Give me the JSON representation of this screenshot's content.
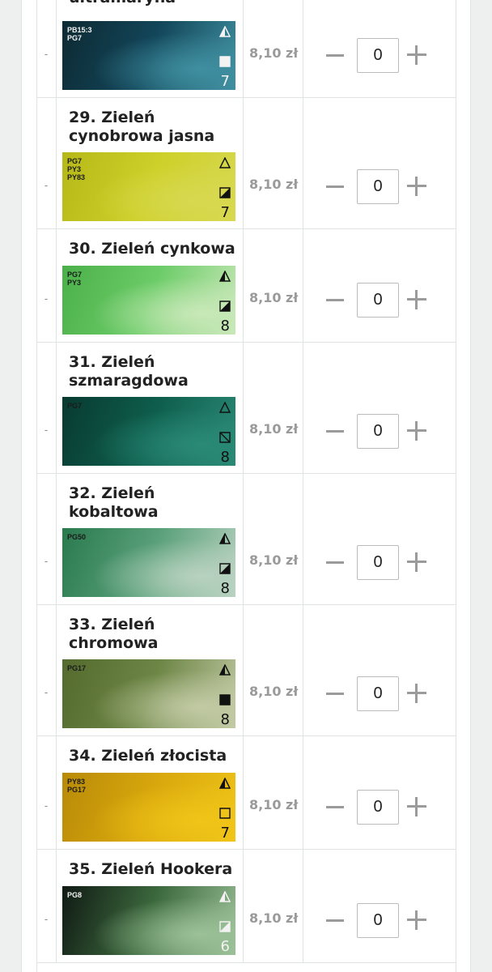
{
  "rows": [
    {
      "dash": "-",
      "title": "ultramaryna",
      "pigments": "PB15:3\nPG7",
      "number": "7",
      "price": "8,10 zł",
      "qty": "0",
      "light_icon": "half-filled-triangle-icon",
      "opacity_icon": "filled-square-icon",
      "colors": [
        "#0d2a33",
        "#13465a",
        "#3f8fa0"
      ]
    },
    {
      "dash": "-",
      "title": "29. Zieleń cynobrowa jasna",
      "pigments": "PG7\nPY3\nPY83",
      "number": "7",
      "price": "8,10 zł",
      "qty": "0",
      "light_icon": "outline-triangle-icon",
      "opacity_icon": "half-filled-square-icon",
      "colors": [
        "#b6b818",
        "#cdd029",
        "#d8d850"
      ]
    },
    {
      "dash": "-",
      "title": "30. Zieleń cynkowa",
      "pigments": "PG7\nPY3",
      "number": "8",
      "price": "8,10 zł",
      "qty": "0",
      "light_icon": "half-filled-triangle-icon",
      "opacity_icon": "half-filled-square-icon",
      "colors": [
        "#4bb04a",
        "#6ccc68",
        "#c8e8b8"
      ]
    },
    {
      "dash": "-",
      "title": "31. Zieleń szmaragdowa",
      "pigments": "PG7",
      "number": "8",
      "price": "8,10 zł",
      "qty": "0",
      "light_icon": "outline-triangle-icon",
      "opacity_icon": "diagonal-square-icon",
      "colors": [
        "#083a30",
        "#0f5e4d",
        "#2a8a76"
      ]
    },
    {
      "dash": "-",
      "title": "32. Zieleń kobaltowa",
      "pigments": "PG50",
      "number": "8",
      "price": "8,10 zł",
      "qty": "0",
      "light_icon": "half-filled-triangle-icon",
      "opacity_icon": "half-filled-square-icon",
      "colors": [
        "#2a7a4e",
        "#5aa07a",
        "#b8d2c0"
      ]
    },
    {
      "dash": "-",
      "title": "33. Zieleń chromowa",
      "pigments": "PG17",
      "number": "8",
      "price": "8,10 zł",
      "qty": "0",
      "light_icon": "half-filled-triangle-icon",
      "opacity_icon": "filled-square-icon",
      "colors": [
        "#546a2e",
        "#6d8646",
        "#c2caa4"
      ]
    },
    {
      "dash": "-",
      "title": "34. Zieleń złocista",
      "pigments": "PY83\nPG17",
      "number": "7",
      "price": "8,10 zł",
      "qty": "0",
      "light_icon": "half-filled-triangle-icon",
      "opacity_icon": "outline-square-icon",
      "colors": [
        "#b88a08",
        "#d9a80d",
        "#f0c418"
      ]
    },
    {
      "dash": "-",
      "title": "35. Zieleń Hookera",
      "pigments": "PG8",
      "number": "6",
      "price": "8,10 zł",
      "qty": "0",
      "light_icon": "half-filled-triangle-icon",
      "opacity_icon": "half-filled-square-icon",
      "colors": [
        "#101a14",
        "#3d6a3e",
        "#9cc198"
      ]
    }
  ]
}
